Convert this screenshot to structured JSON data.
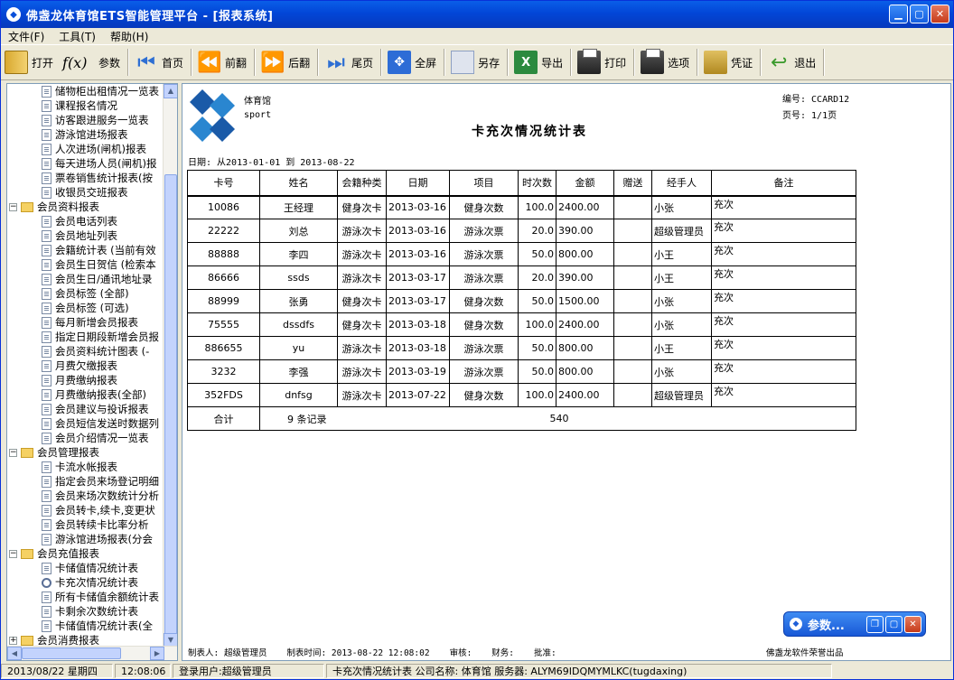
{
  "window": {
    "title": "佛盏龙体育馆ETS智能管理平台 - [报表系统]",
    "app_icon": "ets-logo-icon"
  },
  "menu": [
    {
      "label": "文件(F)"
    },
    {
      "label": "工具(T)"
    },
    {
      "label": "帮助(H)"
    }
  ],
  "toolbar": {
    "open": "打开",
    "params": "参数",
    "first": "首页",
    "prev": "前翻",
    "next": "后翻",
    "last": "尾页",
    "fullscreen": "全屏",
    "save_as": "另存",
    "export": "导出",
    "print": "打印",
    "options": "选项",
    "voucher": "凭证",
    "exit": "退出"
  },
  "tree": [
    {
      "type": "leaf",
      "label": "储物柜出租情况一览表"
    },
    {
      "type": "leaf",
      "label": "课程报名情况"
    },
    {
      "type": "leaf",
      "label": "访客跟进服务一览表"
    },
    {
      "type": "leaf",
      "label": "游泳馆进场报表"
    },
    {
      "type": "leaf",
      "label": "人次进场(闸机)报表"
    },
    {
      "type": "leaf",
      "label": "每天进场人员(闸机)报"
    },
    {
      "type": "leaf",
      "label": "票卷销售统计报表(按"
    },
    {
      "type": "leaf",
      "label": "收银员交班报表"
    },
    {
      "type": "group",
      "label": "会员资料报表"
    },
    {
      "type": "leaf",
      "label": "会员电话列表"
    },
    {
      "type": "leaf",
      "label": "会员地址列表"
    },
    {
      "type": "leaf",
      "label": "会籍统计表 (当前有效"
    },
    {
      "type": "leaf",
      "label": "会员生日贺信 (检索本"
    },
    {
      "type": "leaf",
      "label": "会员生日/通讯地址录"
    },
    {
      "type": "leaf",
      "label": "会员标签 (全部)"
    },
    {
      "type": "leaf",
      "label": "会员标签 (可选)"
    },
    {
      "type": "leaf",
      "label": "每月新增会员报表"
    },
    {
      "type": "leaf",
      "label": "指定日期段新增会员报"
    },
    {
      "type": "leaf",
      "label": "会员资料统计图表 (-"
    },
    {
      "type": "leaf",
      "label": "月费欠缴报表"
    },
    {
      "type": "leaf",
      "label": "月费缴纳报表"
    },
    {
      "type": "leaf",
      "label": "月费缴纳报表(全部)"
    },
    {
      "type": "leaf",
      "label": "会员建议与投诉报表"
    },
    {
      "type": "leaf",
      "label": "会员短信发送时数据列"
    },
    {
      "type": "leaf",
      "label": "会员介绍情况一览表"
    },
    {
      "type": "group",
      "label": "会员管理报表"
    },
    {
      "type": "leaf",
      "label": "卡流水帐报表"
    },
    {
      "type": "leaf",
      "label": "指定会员来场登记明细"
    },
    {
      "type": "leaf",
      "label": "会员来场次数统计分析"
    },
    {
      "type": "leaf",
      "label": "会员转卡,续卡,变更状"
    },
    {
      "type": "leaf",
      "label": "会员转续卡比率分析"
    },
    {
      "type": "leaf",
      "label": "游泳馆进场报表(分会"
    },
    {
      "type": "group",
      "label": "会员充值报表"
    },
    {
      "type": "leaf",
      "label": "卡储值情况统计表"
    },
    {
      "type": "leaf",
      "label": "卡充次情况统计表",
      "selected": true
    },
    {
      "type": "leaf",
      "label": "所有卡储值余额统计表"
    },
    {
      "type": "leaf",
      "label": "卡剩余次数统计表"
    },
    {
      "type": "leaf",
      "label": "卡储值情况统计表(全"
    },
    {
      "type": "group",
      "label": "会员消费报表"
    }
  ],
  "report": {
    "logo_text_1": "体育馆",
    "logo_text_2": "sport",
    "report_no": "编号: CCARD12",
    "page": "页号:    1/1页",
    "title": "卡充次情况统计表",
    "date_range": "日期: 从2013-01-01 到 2013-08-22",
    "columns": [
      "卡号",
      "姓名",
      "会籍种类",
      "日期",
      "项目",
      "时次数",
      "金额",
      "赠送",
      "经手人",
      "备注"
    ],
    "rows": [
      {
        "card": "10086",
        "name": "王经理",
        "type": "健身次卡",
        "date": "2013-03-16",
        "item": "健身次数",
        "count": "100.0",
        "amount": "2400.00",
        "gift": "",
        "handler": "小张",
        "note": "充次"
      },
      {
        "card": "22222",
        "name": "刘总",
        "type": "游泳次卡",
        "date": "2013-03-16",
        "item": "游泳次票",
        "count": "20.0",
        "amount": "390.00",
        "gift": "",
        "handler": "超级管理员",
        "note": "充次"
      },
      {
        "card": "88888",
        "name": "李四",
        "type": "游泳次卡",
        "date": "2013-03-16",
        "item": "游泳次票",
        "count": "50.0",
        "amount": "800.00",
        "gift": "",
        "handler": "小王",
        "note": "充次"
      },
      {
        "card": "86666",
        "name": "ssds",
        "type": "游泳次卡",
        "date": "2013-03-17",
        "item": "游泳次票",
        "count": "20.0",
        "amount": "390.00",
        "gift": "",
        "handler": "小王",
        "note": "充次"
      },
      {
        "card": "88999",
        "name": "张勇",
        "type": "健身次卡",
        "date": "2013-03-17",
        "item": "健身次数",
        "count": "50.0",
        "amount": "1500.00",
        "gift": "",
        "handler": "小张",
        "note": "充次"
      },
      {
        "card": "75555",
        "name": "dssdfs",
        "type": "健身次卡",
        "date": "2013-03-18",
        "item": "健身次数",
        "count": "100.0",
        "amount": "2400.00",
        "gift": "",
        "handler": "小张",
        "note": "充次"
      },
      {
        "card": "886655",
        "name": "yu",
        "type": "游泳次卡",
        "date": "2013-03-18",
        "item": "游泳次票",
        "count": "50.0",
        "amount": "800.00",
        "gift": "",
        "handler": "小王",
        "note": "充次"
      },
      {
        "card": "3232",
        "name": "李强",
        "type": "游泳次卡",
        "date": "2013-03-19",
        "item": "游泳次票",
        "count": "50.0",
        "amount": "800.00",
        "gift": "",
        "handler": "小张",
        "note": "充次"
      },
      {
        "card": "352FDS",
        "name": "dnfsg",
        "type": "游泳次卡",
        "date": "2013-07-22",
        "item": "健身次数",
        "count": "100.0",
        "amount": "2400.00",
        "gift": "",
        "handler": "超级管理员",
        "note": "充次"
      }
    ],
    "total_label": "合计",
    "total_records": "9 条记录",
    "total_count": "540",
    "footer": {
      "maker": "制表人: 超级管理员",
      "made_time": "制表时间: 2013-08-22 12:08:02",
      "audit": "审核:",
      "finance": "财务:",
      "approve": "批准:",
      "vendor": "佛盏龙软件荣誉出品"
    }
  },
  "param_panel": {
    "label": "参数..."
  },
  "status": {
    "date": "2013/08/22 星期四",
    "time": "12:08:06",
    "user": "登录用户:超级管理员",
    "info": "卡充次情况统计表 公司名称: 体育馆 服务器: ALYM69IDQMYMLKC(tugdaxing)"
  }
}
